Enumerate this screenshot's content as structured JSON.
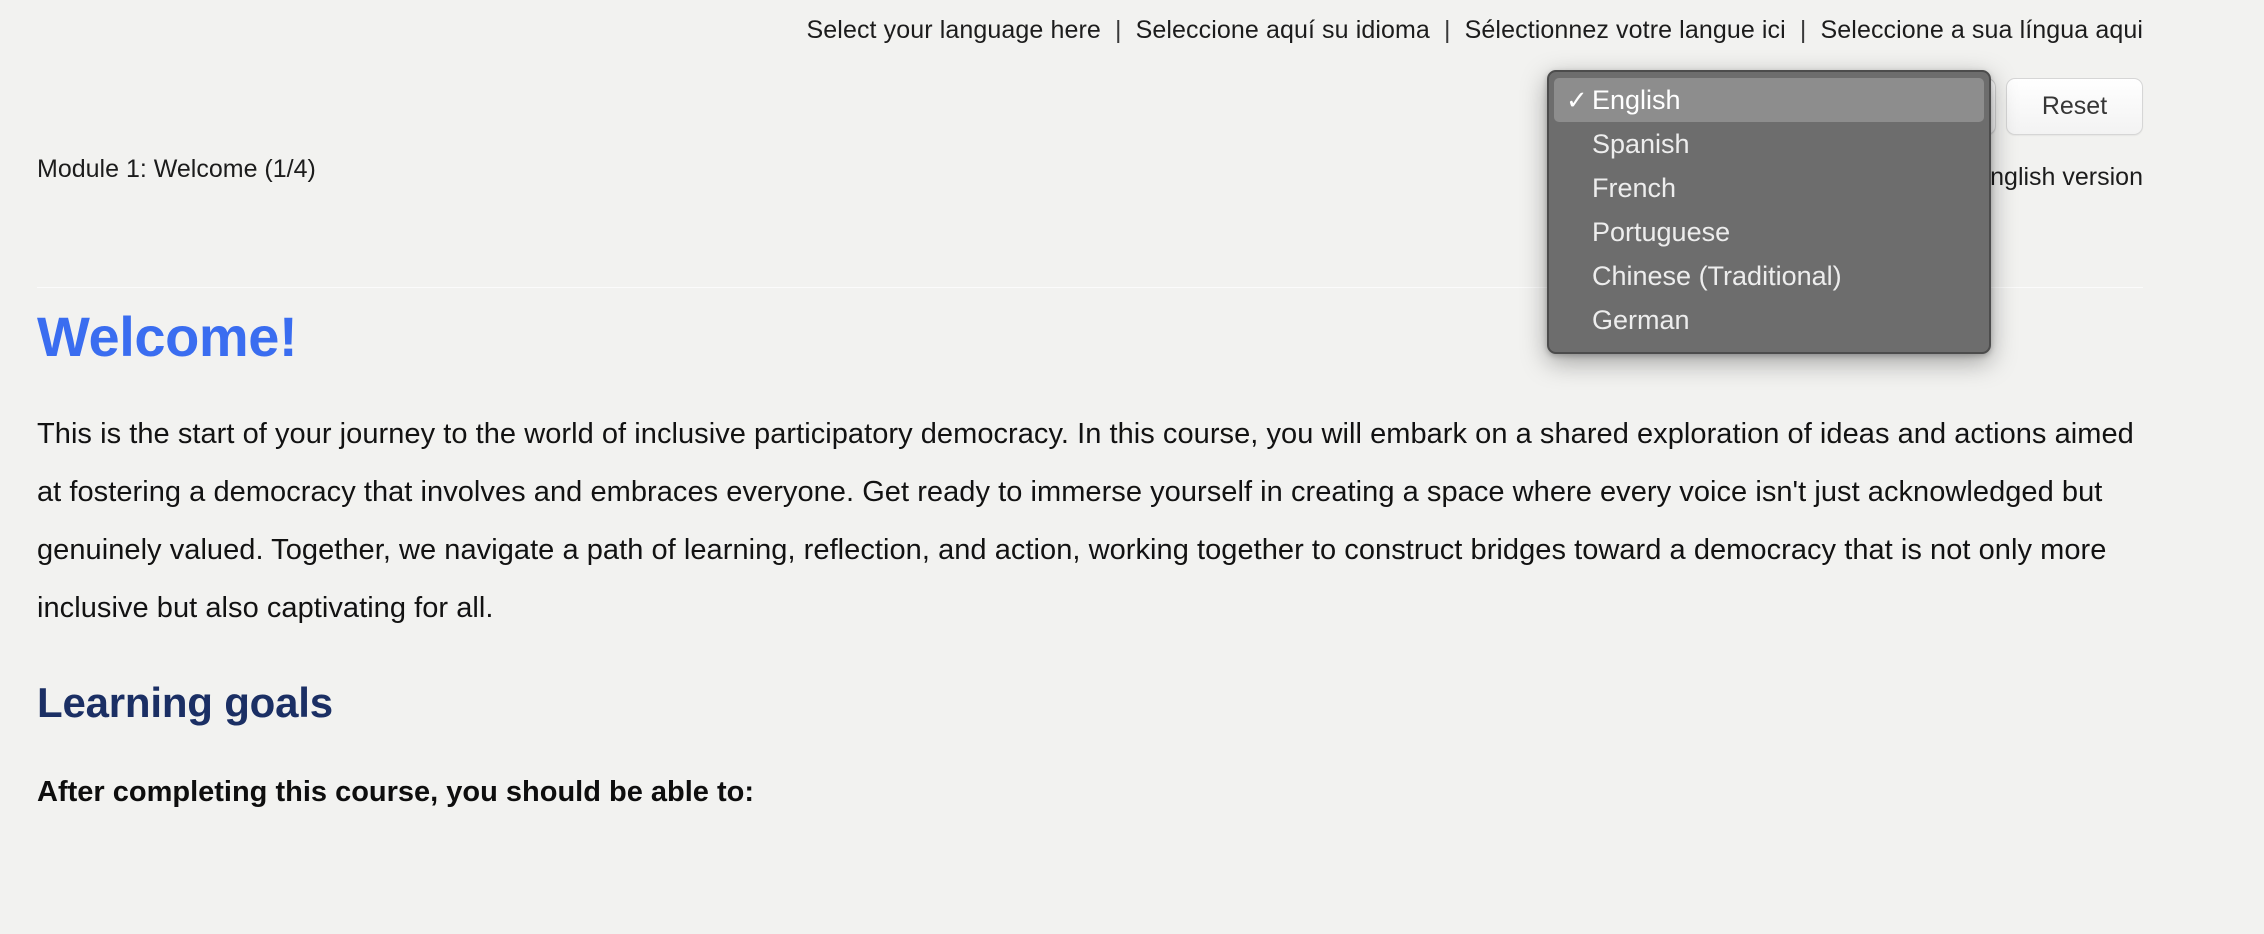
{
  "language_bar": {
    "prompts": [
      "Select your language here",
      "Seleccione aquí su idioma",
      "Sélectionnez votre langue ici",
      "Seleccione a sua língua aqui"
    ],
    "separator": "|"
  },
  "selector": {
    "selected_value": "English",
    "chevron_icon": "chevron-down-icon",
    "reset_label": "Reset"
  },
  "version_note": {
    "text": "Currently displaying English version",
    "visible_fragment": "nglish version"
  },
  "dropdown": {
    "open": true,
    "check_glyph": "✓",
    "selected_index": 0,
    "items": [
      {
        "label": "English",
        "selected": true
      },
      {
        "label": "Spanish",
        "selected": false
      },
      {
        "label": "French",
        "selected": false
      },
      {
        "label": "Portuguese",
        "selected": false
      },
      {
        "label": "Chinese (Traditional)",
        "selected": false
      },
      {
        "label": "German",
        "selected": false
      }
    ]
  },
  "module": {
    "label": "Module 1: Welcome (1/4)"
  },
  "content": {
    "heading": "Welcome!",
    "intro": "This is the start of your journey to the world of inclusive participatory democracy. In this course, you will embark on a shared exploration of ideas and actions aimed at fostering a democracy that involves and embraces everyone. Get ready to immerse yourself in creating a space where every voice isn't just acknowledged but genuinely valued. Together, we navigate a path of learning, reflection, and action, working together to construct bridges toward a democracy that is not only more inclusive but also captivating for all.",
    "goals_heading": "Learning goals",
    "goals_lead": "After completing this course, you should be able to:"
  },
  "colors": {
    "page_background": "#f2f2f0",
    "welcome_blue": "#3a6df0",
    "goals_navy": "#1b2f64",
    "dropdown_background": "#6d6d6d",
    "dropdown_selected": "#8d8d8d",
    "body_text": "#121212"
  }
}
